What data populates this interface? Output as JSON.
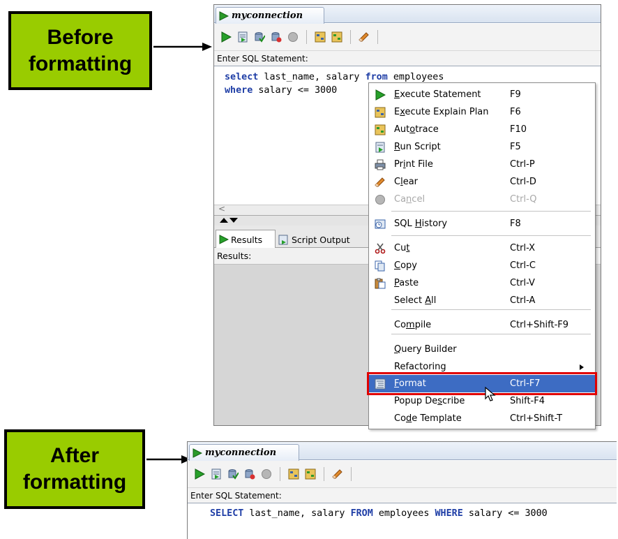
{
  "callouts": {
    "before": "Before formatting",
    "after": "After formatting"
  },
  "top_window": {
    "tab_title": "myconnection",
    "editor_label": "Enter SQL Statement:",
    "code_line1": [
      "select",
      " last_name, salary ",
      "from",
      " employees"
    ],
    "code_line2": [
      "where",
      " salary <= 3000"
    ],
    "results_tab": "Results",
    "script_output_tab": "Script Output",
    "results_label": "Results:"
  },
  "context_menu": {
    "items": [
      {
        "pre": "",
        "ul": "E",
        "post": "xecute Statement",
        "shortcut": "F9",
        "icon": "run-icon"
      },
      {
        "pre": "E",
        "ul": "x",
        "post": "ecute Explain Plan",
        "shortcut": "F6",
        "icon": "explain-plan-icon"
      },
      {
        "pre": "Aut",
        "ul": "o",
        "post": "trace",
        "shortcut": "F10",
        "icon": "autotrace-icon"
      },
      {
        "pre": "",
        "ul": "R",
        "post": "un Script",
        "shortcut": "F5",
        "icon": "run-script-icon"
      },
      {
        "pre": "Pr",
        "ul": "i",
        "post": "nt File",
        "shortcut": "Ctrl-P",
        "icon": "printer-icon"
      },
      {
        "pre": "C",
        "ul": "l",
        "post": "ear",
        "shortcut": "Ctrl-D",
        "icon": "eraser-icon"
      },
      {
        "pre": "Ca",
        "ul": "n",
        "post": "cel",
        "shortcut": "Ctrl-Q",
        "icon": "cancel-icon"
      },
      {
        "pre": "SQL ",
        "ul": "H",
        "post": "istory",
        "shortcut": "F8",
        "icon": "sql-history-icon"
      },
      {
        "pre": "Cu",
        "ul": "t",
        "post": "",
        "shortcut": "Ctrl-X",
        "icon": "scissors-icon"
      },
      {
        "pre": "",
        "ul": "C",
        "post": "opy",
        "shortcut": "Ctrl-C",
        "icon": "copy-icon"
      },
      {
        "pre": "",
        "ul": "P",
        "post": "aste",
        "shortcut": "Ctrl-V",
        "icon": "paste-icon"
      },
      {
        "pre": "Select ",
        "ul": "A",
        "post": "ll",
        "shortcut": "Ctrl-A",
        "icon": ""
      },
      {
        "pre": "Co",
        "ul": "m",
        "post": "pile",
        "shortcut": "Ctrl+Shift-F9",
        "icon": ""
      },
      {
        "pre": "",
        "ul": "Q",
        "post": "uery Builder",
        "shortcut": "",
        "icon": ""
      },
      {
        "pre": "Refactoring",
        "ul": "",
        "post": "",
        "shortcut": "",
        "icon": ""
      },
      {
        "pre": "",
        "ul": "F",
        "post": "ormat",
        "shortcut": "Ctrl-F7",
        "icon": "format-icon"
      },
      {
        "pre": "Popup De",
        "ul": "s",
        "post": "cribe",
        "shortcut": "Shift-F4",
        "icon": ""
      },
      {
        "pre": "Co",
        "ul": "d",
        "post": "e Template",
        "shortcut": "Ctrl+Shift-T",
        "icon": ""
      }
    ]
  },
  "bottom_window": {
    "tab_title": "myconnection",
    "editor_label": "Enter SQL Statement:",
    "code": [
      "SELECT",
      " last_name, salary ",
      "FROM",
      " employees ",
      "WHERE",
      " salary <= 3000"
    ]
  },
  "colors": {
    "callout_bg": "#99cc00",
    "highlight": "#3d6cc3",
    "frame": "#e00000",
    "keyword": "#1f3ea6"
  }
}
